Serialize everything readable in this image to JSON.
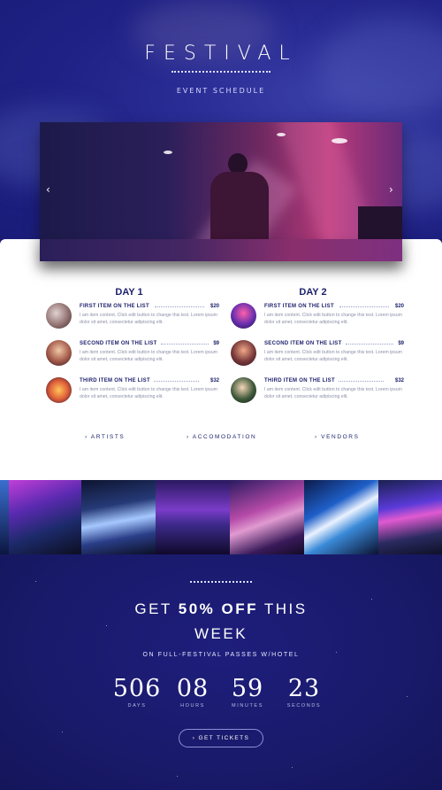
{
  "hero": {
    "title": "FESTIVAL",
    "subtitle": "EVENT SCHEDULE",
    "prev_arrow": "‹",
    "next_arrow": "›"
  },
  "schedule": {
    "day1": {
      "title": "DAY 1",
      "items": [
        {
          "name": "FIRST ITEM ON THE LIST",
          "price": "$20",
          "desc": "I am item content. Click edit button to change this text. Lorem ipsum dolor sit amet, consectetur adipiscing elit."
        },
        {
          "name": "SECOND ITEM ON THE LIST",
          "price": "$9",
          "desc": "I am item content. Click edit button to change this text. Lorem ipsum dolor sit amet, consectetur adipiscing elit."
        },
        {
          "name": "THIRD ITEM ON THE LIST",
          "price": "$32",
          "desc": "I am item content. Click edit button to change this text. Lorem ipsum dolor sit amet, consectetur adipiscing elit."
        }
      ]
    },
    "day2": {
      "title": "DAY 2",
      "items": [
        {
          "name": "FIRST ITEM ON THE LIST",
          "price": "$20",
          "desc": "I am item content. Click edit button to change this text. Lorem ipsum dolor sit amet, consectetur adipiscing elit."
        },
        {
          "name": "SECOND ITEM ON THE LIST",
          "price": "$9",
          "desc": "I am item content. Click edit button to change this text. Lorem ipsum dolor sit amet, consectetur adipiscing elit."
        },
        {
          "name": "THIRD ITEM ON THE LIST",
          "price": "$32",
          "desc": "I am item content. Click edit button to change this text. Lorem ipsum dolor sit amet, consectetur adipiscing elit."
        }
      ]
    }
  },
  "links": {
    "artists": "› ARTISTS",
    "accomodation": "› ACCOMODATION",
    "vendors": "› VENDORS"
  },
  "promo": {
    "line1_pre": "GET ",
    "line1_bold": "50% OFF",
    "line1_post": " THIS",
    "line2": "WEEK",
    "subtitle": "ON FULL-FESTIVAL PASSES W/HOTEL",
    "button": "› GET TICKETS"
  },
  "countdown": {
    "days": {
      "value": "506",
      "label": "DAYS"
    },
    "hours": {
      "value": "08",
      "label": "HOURS"
    },
    "minutes": {
      "value": "59",
      "label": "MINUTES"
    },
    "seconds": {
      "value": "23",
      "label": "SECONDS"
    }
  },
  "colors": {
    "accent": "#1b1f6b",
    "background": "#1a1a6e"
  }
}
